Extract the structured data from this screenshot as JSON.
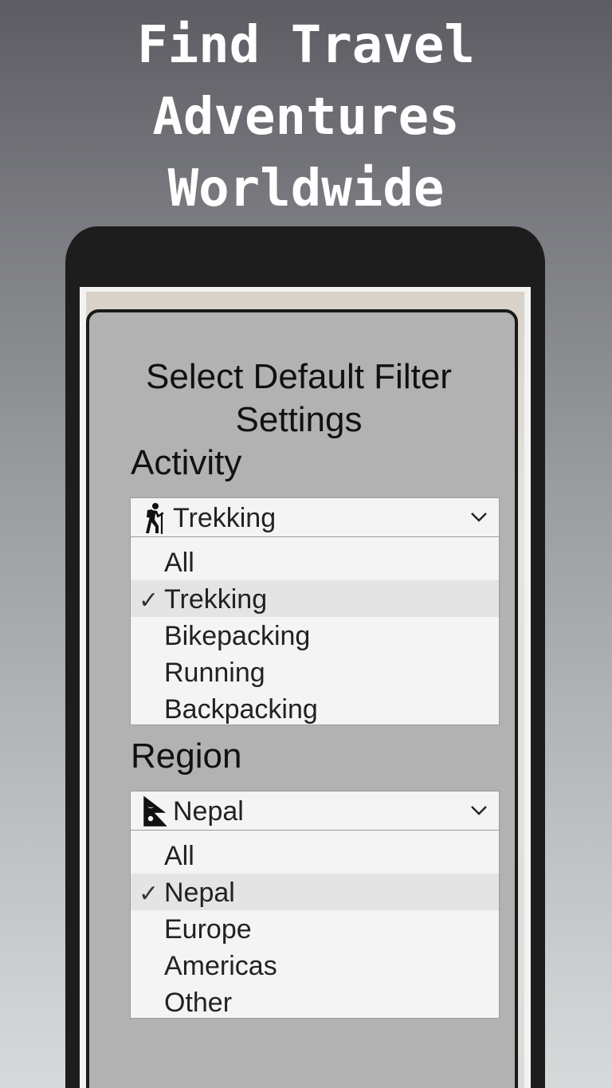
{
  "headline": [
    "Find Travel",
    "Adventures",
    "Worldwide"
  ],
  "dialog": {
    "title_line1": "Select Default Filter",
    "title_line2": "Settings"
  },
  "activity": {
    "label": "Activity",
    "selected": "Trekking",
    "icon": "hiker-icon",
    "options": [
      "All",
      "Trekking",
      "Bikepacking",
      "Running",
      "Backpacking"
    ],
    "selected_index": 1
  },
  "region": {
    "label": "Region",
    "selected": "Nepal",
    "icon": "nepal-flag-icon",
    "options": [
      "All",
      "Nepal",
      "Europe",
      "Americas",
      "Other"
    ],
    "selected_index": 1
  },
  "check_glyph": "✓"
}
